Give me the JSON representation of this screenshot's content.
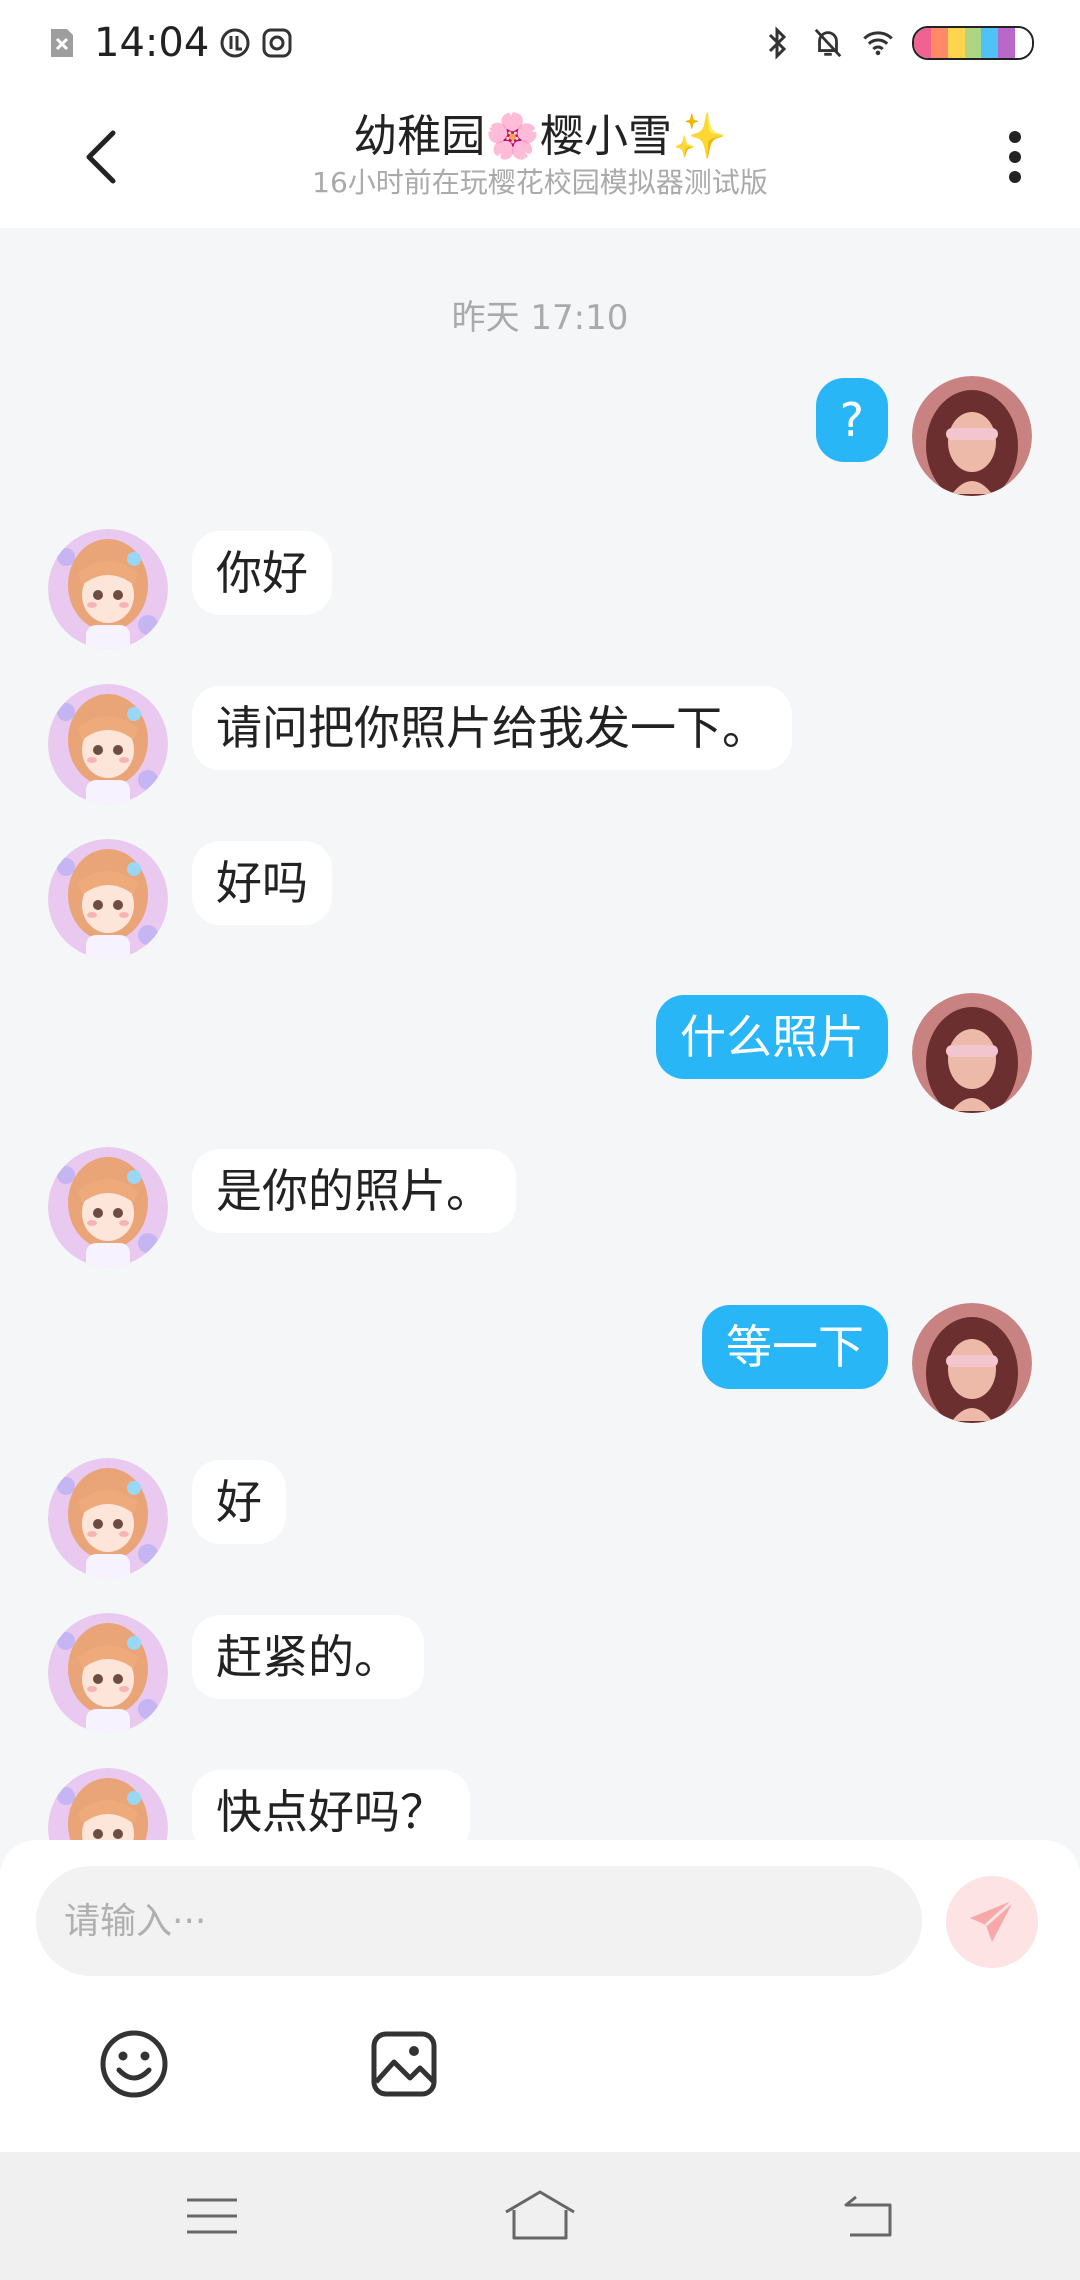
{
  "status_bar": {
    "time": "14:04"
  },
  "header": {
    "title": "幼稚园🌸樱小雪✨",
    "subtitle": "16小时前在玩樱花校园模拟器测试版"
  },
  "conversation": {
    "timestamp": "昨天 17:10",
    "messages": [
      {
        "side": "right",
        "text": "?"
      },
      {
        "side": "left",
        "text": "你好"
      },
      {
        "side": "left",
        "text": "请问把你照片给我发一下。"
      },
      {
        "side": "left",
        "text": "好吗"
      },
      {
        "side": "right",
        "text": "什么照片"
      },
      {
        "side": "left",
        "text": "是你的照片。"
      },
      {
        "side": "right",
        "text": "等一下"
      },
      {
        "side": "left",
        "text": "好"
      },
      {
        "side": "left",
        "text": "赶紧的。"
      },
      {
        "side": "left",
        "text": "快点好吗？"
      }
    ]
  },
  "composer": {
    "placeholder": "请输入···",
    "value": ""
  },
  "colors": {
    "outgoing_bubble": "#29b6f6",
    "incoming_bubble": "#ffffff",
    "send_button": "#fde3e3",
    "send_icon": "#f7a8a8"
  },
  "icons": {
    "back": "chevron-left-icon",
    "more": "more-vertical-icon",
    "send": "paper-plane-icon",
    "emoji": "smiley-icon",
    "image": "image-icon",
    "nav_menu": "menu-icon",
    "nav_home": "home-icon",
    "nav_back": "return-icon"
  }
}
